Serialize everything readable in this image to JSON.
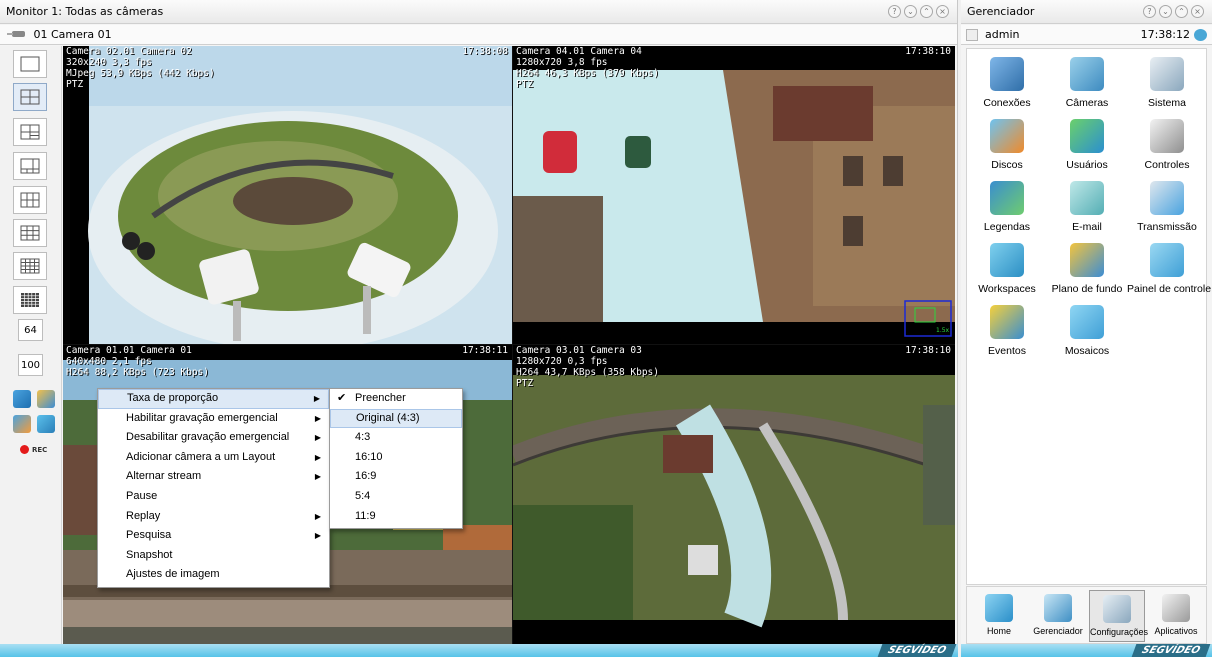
{
  "monitor": {
    "title": "Monitor 1: Todas as câmeras",
    "selected_camera": "01 Camera 01",
    "layout_buttons": [
      "64",
      "100"
    ],
    "rec_label": "REC"
  },
  "cameras": [
    {
      "title": "Camera 02.01 Camera 02",
      "line2": "320x240 3,3 fps",
      "line3": "MJpeg 53,9 KBps (442 Kbps)",
      "line4": "PTZ",
      "time": "17:38:08"
    },
    {
      "title": "Camera 04.01 Camera 04",
      "line2": "1280x720 3,8 fps",
      "line3": "H264 46,3 KBps (379 Kbps)",
      "line4": "PTZ",
      "time": "17:38:10"
    },
    {
      "title": "Camera 01.01 Camera 01",
      "line2": "640x480 2,1 fps",
      "line3": "H264 88,2 KBps (723 Kbps)",
      "line4": "",
      "time": "17:38:11"
    },
    {
      "title": "Camera 03.01 Camera 03",
      "line2": "1280x720 0,3 fps",
      "line3": "H264 43,7 KBps (358 Kbps)",
      "line4": "PTZ",
      "time": "17:38:10"
    }
  ],
  "context_menu": {
    "items": [
      "Taxa de proporção",
      "Habilitar gravação emergencial",
      "Desabilitar gravação emergencial",
      "Adicionar câmera a um Layout",
      "Alternar stream",
      "Pause",
      "Replay",
      "Pesquisa",
      "Snapshot",
      "Ajustes de imagem"
    ],
    "submenu": [
      "Preencher",
      "Original (4:3)",
      "4:3",
      "16:10",
      "16:9",
      "5:4",
      "11:9"
    ],
    "checked_glyph": "✔"
  },
  "manager": {
    "title": "Gerenciador",
    "user": "admin",
    "time": "17:38:12",
    "tiles": [
      "Conexões",
      "Câmeras",
      "Sistema",
      "Discos",
      "Usuários",
      "Controles",
      "Legendas",
      "E-mail",
      "Transmissão",
      "Workspaces",
      "Plano de fundo",
      "Painel de controle",
      "Eventos",
      "Mosaicos"
    ],
    "nav": [
      "Home",
      "Gerenciador",
      "Configurações",
      "Aplicativos"
    ]
  },
  "brand": "SEGVÍDEO",
  "colors": {
    "accent": "#56c3e8",
    "menu_highlight": "#dde9f6",
    "rec": "#e41b1b"
  },
  "mini_osd": "1.5x"
}
